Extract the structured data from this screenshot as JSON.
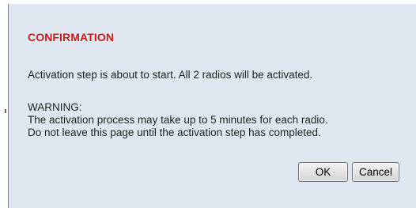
{
  "dialog": {
    "title": "CONFIRMATION",
    "message": "Activation step is about to start. All 2 radios will be activated.",
    "warning_heading": "WARNING:",
    "warning_line_1": "The activation process may take up to 5 minutes for each radio.",
    "warning_line_2": "Do not leave this page until the activation step has completed.",
    "ok_label": "OK",
    "cancel_label": "Cancel"
  },
  "colors": {
    "dialog_background": "#dfe8f0",
    "title_red": "#cc1a1a",
    "text": "#1f1f1f"
  }
}
